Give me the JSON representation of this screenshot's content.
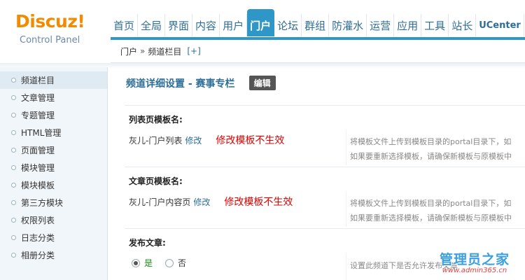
{
  "logo": {
    "brand": "Discuz!",
    "subtitle": "Control Panel"
  },
  "nav": {
    "items": [
      {
        "label": "首页"
      },
      {
        "label": "全局"
      },
      {
        "label": "界面"
      },
      {
        "label": "内容"
      },
      {
        "label": "用户"
      },
      {
        "label": "门户"
      },
      {
        "label": "论坛"
      },
      {
        "label": "群组"
      },
      {
        "label": "防灌水"
      },
      {
        "label": "运营"
      },
      {
        "label": "应用"
      },
      {
        "label": "工具"
      },
      {
        "label": "站长"
      },
      {
        "label": "UCenter"
      }
    ],
    "active": "门户"
  },
  "breadcrumb": {
    "root": "门户",
    "separator": "»",
    "current": "频道栏目",
    "add": "[+]"
  },
  "sidebar": {
    "items": [
      {
        "label": "频道栏目"
      },
      {
        "label": "文章管理"
      },
      {
        "label": "专题管理"
      },
      {
        "label": "HTML管理"
      },
      {
        "label": "页面管理"
      },
      {
        "label": "模块管理"
      },
      {
        "label": "模块模板"
      },
      {
        "label": "第三方模块"
      },
      {
        "label": "权限列表"
      },
      {
        "label": "日志分类"
      },
      {
        "label": "相册分类"
      }
    ],
    "active": "频道栏目"
  },
  "main": {
    "title": "频道详细设置 - 赛事专栏",
    "edit_label": "编辑",
    "list_template": {
      "heading": "列表页模板名:",
      "value": "灰儿-门户列表",
      "modify": "修改",
      "warning": "修改模板不生效",
      "tip_line1": "将模板文件上传到模板目录的portal目录下，如",
      "tip_line2": "如果要重新选择模板，请确保新模板与原模板中"
    },
    "article_template": {
      "heading": "文章页模板名:",
      "value": "灰儿-门户内容页",
      "modify": "修改",
      "warning": "修改模板不生效",
      "tip_line1": "将模板文件上传到模板目录的portal目录下，如",
      "tip_line2": "如果要重新选择模板，请确保新模板与原模板中"
    },
    "publish": {
      "heading": "发布文章:",
      "yes": "是",
      "no": "否",
      "selected": "是",
      "tip": "设置此频道下是否允许发布文章"
    }
  },
  "watermark": {
    "text": "管理员之家",
    "url": "www.admin365.cn"
  },
  "colors": {
    "accent": "#2e97c8",
    "brand": "#f18c00",
    "warning": "#e00000",
    "link": "#2d6e98"
  }
}
